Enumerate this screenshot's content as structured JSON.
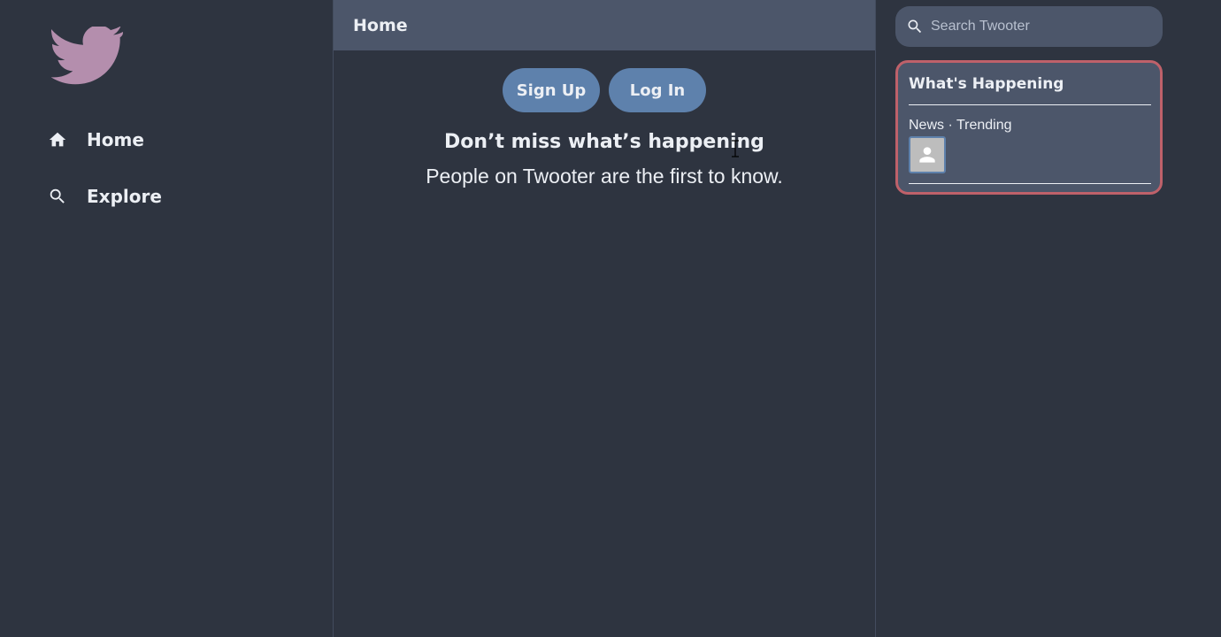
{
  "app": {
    "name": "Twooter"
  },
  "nav": {
    "items": [
      {
        "label": "Home",
        "icon": "home-icon"
      },
      {
        "label": "Explore",
        "icon": "search-icon"
      }
    ]
  },
  "main": {
    "header_title": "Home",
    "signup_label": "Sign Up",
    "login_label": "Log In",
    "headline": "Don’t miss what’s happening",
    "subline": "People on Twooter are the first to know."
  },
  "sidebar": {
    "search_placeholder": "Search Twooter",
    "happening": {
      "title": "What's Happening",
      "trend_meta": "News · Trending"
    }
  },
  "colors": {
    "background": "#2e3440",
    "panel": "#4c566a",
    "accent": "#5e81ac",
    "logo": "#b48ead",
    "card_border": "#bf616a",
    "text": "#eceff4"
  }
}
